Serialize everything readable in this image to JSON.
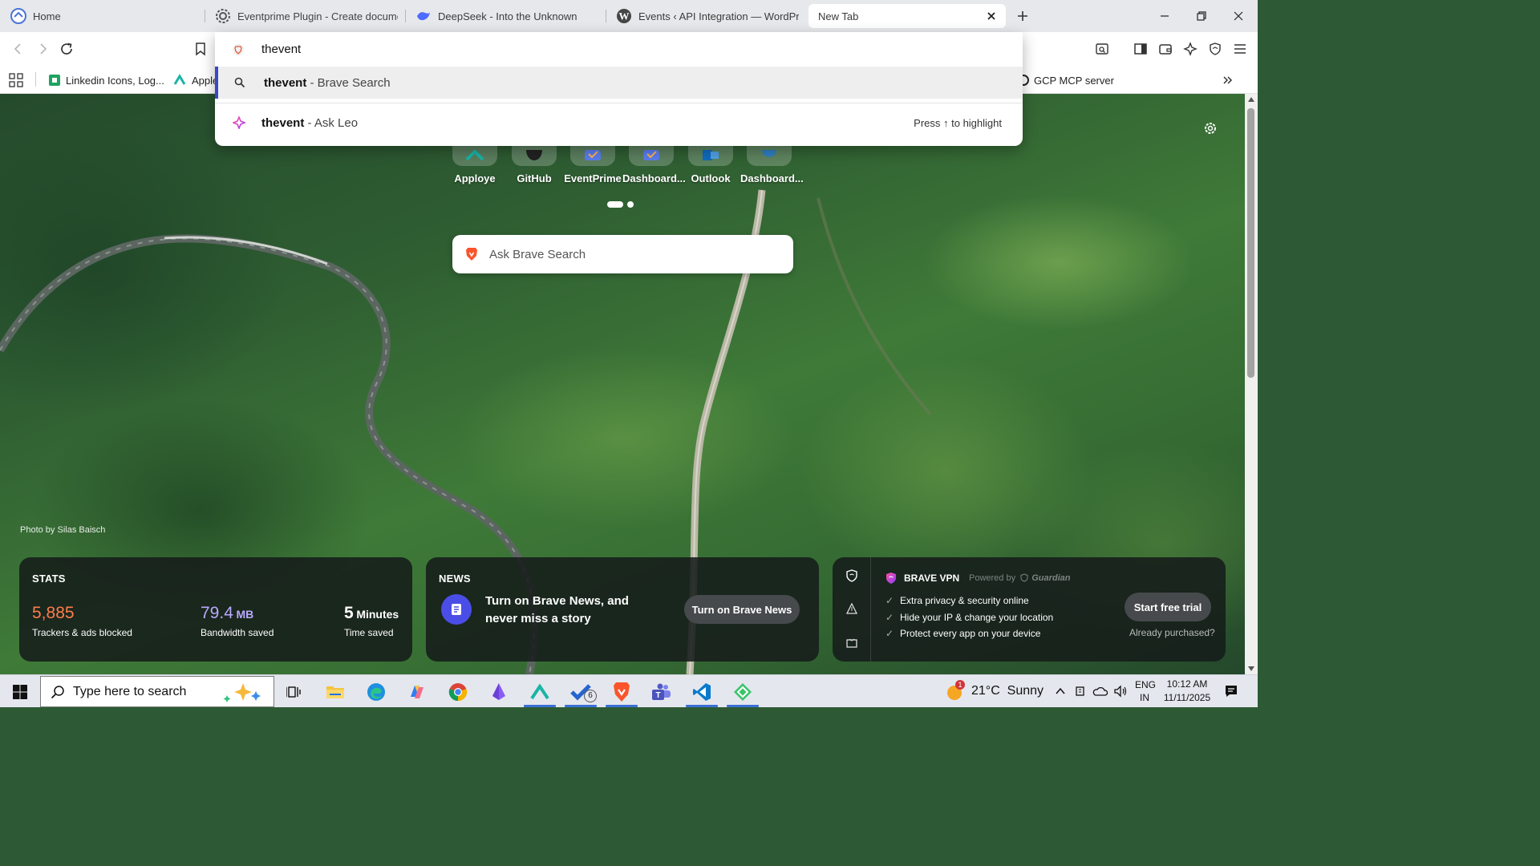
{
  "tabs": [
    {
      "title": "Home"
    },
    {
      "title": "Eventprime Plugin - Create documen"
    },
    {
      "title": "DeepSeek - Into the Unknown"
    },
    {
      "title": "Events ‹ API Integration — WordPres"
    },
    {
      "title": "New Tab"
    }
  ],
  "omnibox": {
    "query": "thevent",
    "suggestions": [
      {
        "bold": "thevent",
        "rest": " - Brave Search",
        "icon": "search-icon"
      },
      {
        "bold": "thevent",
        "rest": " - Ask Leo",
        "icon": "leo-icon",
        "hint": "Press ↑ to highlight"
      }
    ]
  },
  "bookmarks": [
    {
      "label": "Linkedin Icons, Log..."
    },
    {
      "label": "Apple"
    },
    {
      "label": "GCP MCP server"
    }
  ],
  "top_sites": [
    {
      "label": "Apploye"
    },
    {
      "label": "GitHub"
    },
    {
      "label": "EventPrime"
    },
    {
      "label": "Dashboard..."
    },
    {
      "label": "Outlook"
    },
    {
      "label": "Dashboard..."
    }
  ],
  "search": {
    "placeholder": "Ask Brave Search"
  },
  "photo_credit": "Photo by Silas Baisch",
  "stats": {
    "title": "STATS",
    "trackers_value": "5,885",
    "trackers_label": "Trackers & ads blocked",
    "bandwidth_value": "79.4",
    "bandwidth_unit": "MB",
    "bandwidth_label": "Bandwidth saved",
    "time_value": "5",
    "time_unit": "Minutes",
    "time_label": "Time saved"
  },
  "news": {
    "title": "NEWS",
    "text": "Turn on Brave News, and never miss a story",
    "button": "Turn on Brave News"
  },
  "vpn": {
    "title": "BRAVE VPN",
    "powered_by": "Powered by",
    "partner": "Guardian",
    "features": [
      "Extra privacy & security online",
      "Hide your IP & change your location",
      "Protect every app on your device"
    ],
    "button": "Start free trial",
    "already": "Already purchased?"
  },
  "taskbar": {
    "search_placeholder": "Type here to search",
    "weather": "21°C  Sunny",
    "weather_badge": "1",
    "lang_top": "ENG",
    "lang_bottom": "IN",
    "time": "10:12 AM",
    "date": "11/11/2025",
    "todo_badge": "6"
  },
  "colors": {
    "stats_orange": "#ff7d4b",
    "stats_purple": "#b9a9ff",
    "brave_orange": "#fb542b",
    "taskbar_accent": "#3a6fd8"
  }
}
